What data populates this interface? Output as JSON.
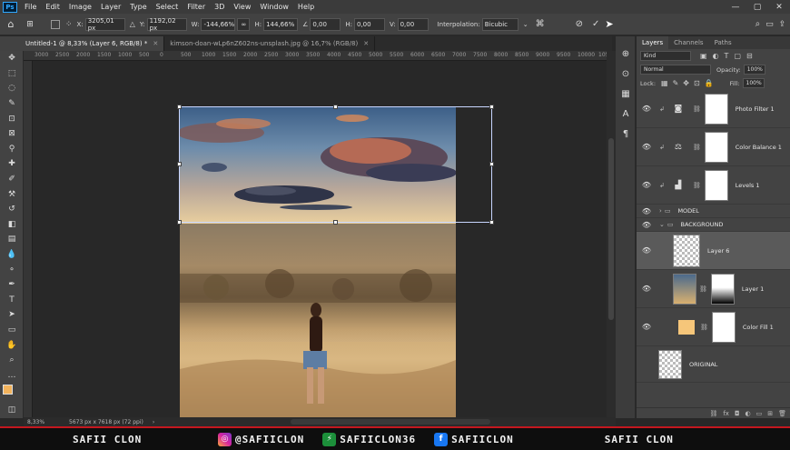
{
  "app": {
    "logo": "Ps"
  },
  "menu": [
    "File",
    "Edit",
    "Image",
    "Layer",
    "Type",
    "Select",
    "Filter",
    "3D",
    "View",
    "Window",
    "Help"
  ],
  "window_controls": [
    "—",
    "▢",
    "✕"
  ],
  "options": {
    "x_label": "X:",
    "x_value": "3205,01 px",
    "y_label": "Y:",
    "y_value": "1192,02 px",
    "w_label": "W:",
    "w_value": "-144,66%",
    "h_label": "H:",
    "h_value": "144,66%",
    "angle_value": "0,00",
    "hskew_label": "H:",
    "hskew_value": "0,00",
    "vskew_label": "V:",
    "vskew_value": "0,00",
    "interp_label": "Interpolation:",
    "interp_value": "Bicubic"
  },
  "tabs": [
    {
      "label": "Untitled-1 @ 8,33% (Layer 6, RGB/8) *"
    },
    {
      "label": "kimson-doan-wLp6nZ602ns-unsplash.jpg @ 16,7% (RGB/8)"
    }
  ],
  "ruler_labels": [
    "3000",
    "2500",
    "2000",
    "1500",
    "1000",
    "500",
    "0",
    "500",
    "1000",
    "1500",
    "2000",
    "2500",
    "3000",
    "3500",
    "4000",
    "4500",
    "5000",
    "5500",
    "6000",
    "6500",
    "7000",
    "7500",
    "8000",
    "8500",
    "9000",
    "9500",
    "10000",
    "10500"
  ],
  "status": {
    "zoom": "8,33%",
    "doc": "5673 px x 7618 px (72 ppi)"
  },
  "panel": {
    "tabs": [
      "Layers",
      "Channels",
      "Paths"
    ],
    "kind_placeholder": "Kind",
    "blend_mode": "Normal",
    "opacity_label": "Opacity:",
    "opacity_value": "100%",
    "lock_label": "Lock:",
    "fill_label": "Fill:",
    "fill_value": "100%",
    "layers": [
      {
        "name": "Photo Filter 1",
        "icon": "camera-icon"
      },
      {
        "name": "Color Balance 1",
        "icon": "balance-icon"
      },
      {
        "name": "Levels 1",
        "icon": "levels-icon"
      },
      {
        "name": "MODEL"
      },
      {
        "name": "BACKGROUND"
      },
      {
        "name": "Layer 6"
      },
      {
        "name": "Layer 1"
      },
      {
        "name": "Color Fill 1",
        "swatch": "#f6c67a"
      },
      {
        "name": "ORIGINAL"
      }
    ]
  },
  "banner": {
    "left_brand": "SAFII CLON",
    "instagram": "@SAFIICLON",
    "other": "SAFIICLON36",
    "facebook": "SAFIICLON",
    "right_brand": "SAFII CLON",
    "accent": "#c4171f"
  }
}
